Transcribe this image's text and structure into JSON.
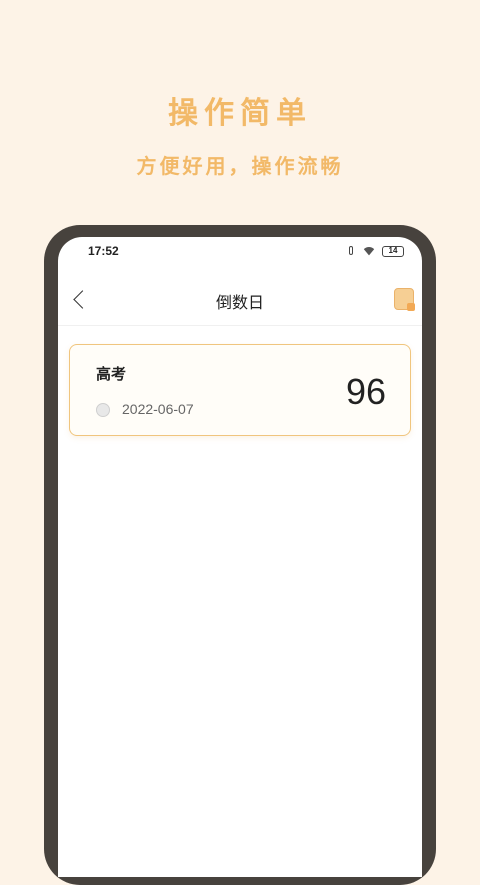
{
  "promo": {
    "title": "操作简单",
    "subtitle": "方便好用，操作流畅"
  },
  "status_bar": {
    "time": "17:52",
    "battery": "14"
  },
  "nav": {
    "title": "倒数日"
  },
  "countdowns": [
    {
      "title": "高考",
      "date": "2022-06-07",
      "days": "96"
    }
  ],
  "colors": {
    "background": "#fdf3e7",
    "accent": "#f2b968",
    "card_border": "#f0c57e",
    "phone_frame": "#47423d"
  },
  "icons": [
    "back-icon",
    "add-icon",
    "clock-icon",
    "wifi-icon",
    "battery-icon",
    "vibrate-icon"
  ]
}
